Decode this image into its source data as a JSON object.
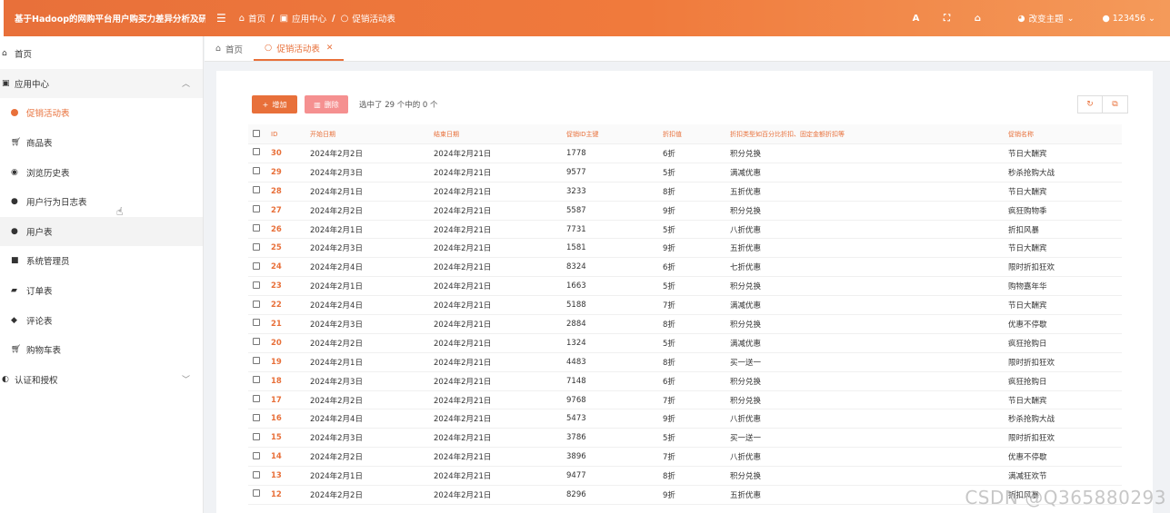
{
  "header": {
    "brand": "基于Hadoop的网购平台用户购买力差异分析及研究",
    "breadcrumb": [
      "首页",
      "应用中心",
      "促销活动表"
    ],
    "theme_label": "改变主题",
    "user_label": "123456",
    "icons": [
      "font-size-icon",
      "fullscreen-icon",
      "home-icon",
      "palette-icon",
      "user-icon"
    ]
  },
  "sidebar": {
    "home": "首页",
    "app_center": "应用中心",
    "items": [
      {
        "label": "促销活动表",
        "icon": "dot"
      },
      {
        "label": "商品表",
        "icon": "cart-icon"
      },
      {
        "label": "浏览历史表",
        "icon": "eye-icon"
      },
      {
        "label": "用户行为日志表",
        "icon": "user-icon"
      },
      {
        "label": "用户表",
        "icon": "user-icon"
      },
      {
        "label": "系统管理员",
        "icon": "square-icon"
      },
      {
        "label": "订单表",
        "icon": "bag-icon"
      },
      {
        "label": "评论表",
        "icon": "comments-icon"
      },
      {
        "label": "购物车表",
        "icon": "cart-icon"
      }
    ],
    "auth": "认证和授权"
  },
  "tabs": [
    {
      "label": "首页"
    },
    {
      "label": "促销活动表"
    }
  ],
  "toolbar": {
    "add_label": "增加",
    "delete_label": "删除",
    "selection_info": "选中了 29 个中的 0 个"
  },
  "table": {
    "columns": [
      "ID",
      "开始日期",
      "结束日期",
      "促销ID主键",
      "折扣值",
      "折扣类型如百分比折扣、固定金额折扣等",
      "促销名称"
    ],
    "rows": [
      [
        "30",
        "2024年2月2日",
        "2024年2月21日",
        "1778",
        "6折",
        "积分兑换",
        "节日大酬宾"
      ],
      [
        "29",
        "2024年2月3日",
        "2024年2月21日",
        "9577",
        "5折",
        "满减优惠",
        "秒杀抢购大战"
      ],
      [
        "28",
        "2024年2月1日",
        "2024年2月21日",
        "3233",
        "8折",
        "五折优惠",
        "节日大酬宾"
      ],
      [
        "27",
        "2024年2月2日",
        "2024年2月21日",
        "5587",
        "9折",
        "积分兑换",
        "疯狂购物季"
      ],
      [
        "26",
        "2024年2月1日",
        "2024年2月21日",
        "7731",
        "5折",
        "八折优惠",
        "折扣风暴"
      ],
      [
        "25",
        "2024年2月3日",
        "2024年2月21日",
        "1581",
        "9折",
        "五折优惠",
        "节日大酬宾"
      ],
      [
        "24",
        "2024年2月4日",
        "2024年2月21日",
        "8324",
        "6折",
        "七折优惠",
        "限时折扣狂欢"
      ],
      [
        "23",
        "2024年2月1日",
        "2024年2月21日",
        "1663",
        "5折",
        "积分兑换",
        "购物嘉年华"
      ],
      [
        "22",
        "2024年2月4日",
        "2024年2月21日",
        "5188",
        "7折",
        "满减优惠",
        "节日大酬宾"
      ],
      [
        "21",
        "2024年2月3日",
        "2024年2月21日",
        "2884",
        "8折",
        "积分兑换",
        "优惠不停歇"
      ],
      [
        "20",
        "2024年2月2日",
        "2024年2月21日",
        "1324",
        "5折",
        "满减优惠",
        "疯狂抢购日"
      ],
      [
        "19",
        "2024年2月1日",
        "2024年2月21日",
        "4483",
        "8折",
        "买一送一",
        "限时折扣狂欢"
      ],
      [
        "18",
        "2024年2月3日",
        "2024年2月21日",
        "7148",
        "6折",
        "积分兑换",
        "疯狂抢购日"
      ],
      [
        "17",
        "2024年2月2日",
        "2024年2月21日",
        "9768",
        "7折",
        "积分兑换",
        "节日大酬宾"
      ],
      [
        "16",
        "2024年2月4日",
        "2024年2月21日",
        "5473",
        "9折",
        "八折优惠",
        "秒杀抢购大战"
      ],
      [
        "15",
        "2024年2月3日",
        "2024年2月21日",
        "3786",
        "5折",
        "买一送一",
        "限时折扣狂欢"
      ],
      [
        "14",
        "2024年2月2日",
        "2024年2月21日",
        "3896",
        "7折",
        "八折优惠",
        "优惠不停歇"
      ],
      [
        "13",
        "2024年2月1日",
        "2024年2月21日",
        "9477",
        "8折",
        "积分兑换",
        "满减狂欢节"
      ],
      [
        "12",
        "2024年2月2日",
        "2024年2月21日",
        "8296",
        "9折",
        "五折优惠",
        "折扣风暴"
      ]
    ]
  },
  "watermark": "CSDN @Q365880293",
  "colors": {
    "accent": "#e8703a",
    "danger": "#f59090"
  }
}
